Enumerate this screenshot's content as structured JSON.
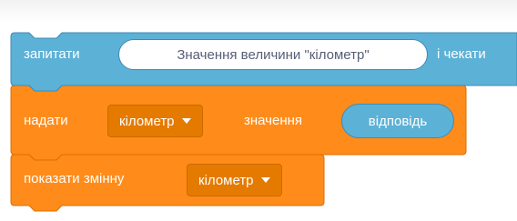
{
  "colors": {
    "sensing": "#5cb1d6",
    "sensing_border": "#3f8ab7",
    "variables": "#ff8c1a",
    "variables_border": "#db6e00",
    "dropdown": "#e57a00"
  },
  "blocks": {
    "ask": {
      "label_before": "запитати",
      "input_value": "Значення величини \"кілометр\"",
      "label_after": "і чекати"
    },
    "set_variable": {
      "label_set": "надати",
      "variable": "кілометр",
      "label_value": "значення",
      "reporter": "відповідь"
    },
    "show_variable": {
      "label": "показати змінну",
      "variable": "кілометр"
    }
  },
  "icons": [
    "chevron-down-icon"
  ]
}
